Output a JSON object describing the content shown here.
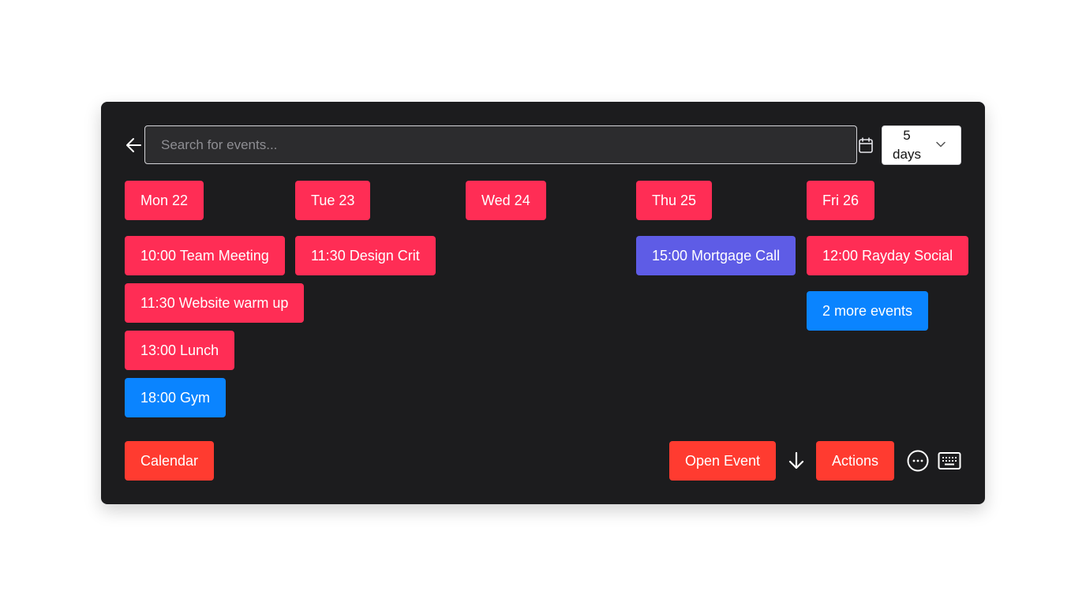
{
  "search": {
    "placeholder": "Search for events...",
    "value": ""
  },
  "range_select": {
    "selected": "5 days"
  },
  "days": [
    {
      "label": "Mon 22"
    },
    {
      "label": "Tue 23"
    },
    {
      "label": "Wed 24"
    },
    {
      "label": "Thu 25"
    },
    {
      "label": "Fri 26"
    }
  ],
  "events": {
    "mon": [
      "10:00 Team Meeting",
      "11:30 Website warm up",
      "13:00 Lunch",
      "18:00 Gym"
    ],
    "tue": [
      "11:30 Design Crit"
    ],
    "thu": [
      "15:00 Mortgage Call"
    ],
    "fri": [
      "12:00 Rayday Social"
    ],
    "fri_more": "2 more events"
  },
  "footer": {
    "calendar_label": "Calendar",
    "open_event_label": "Open Event",
    "actions_label": "Actions"
  },
  "colors": {
    "panel_bg": "#1c1c1e",
    "event_pink": "#ff2d55",
    "event_blue": "#0a84ff",
    "event_indigo": "#5e5ce6",
    "action_red": "#ff3b30"
  },
  "icons": {
    "back": "arrow-left-icon",
    "calendar": "calendar-icon",
    "dropdown": "chevron-down-icon",
    "down": "arrow-down-icon",
    "more": "more-horizontal-circle-icon",
    "keyboard": "keyboard-icon"
  }
}
